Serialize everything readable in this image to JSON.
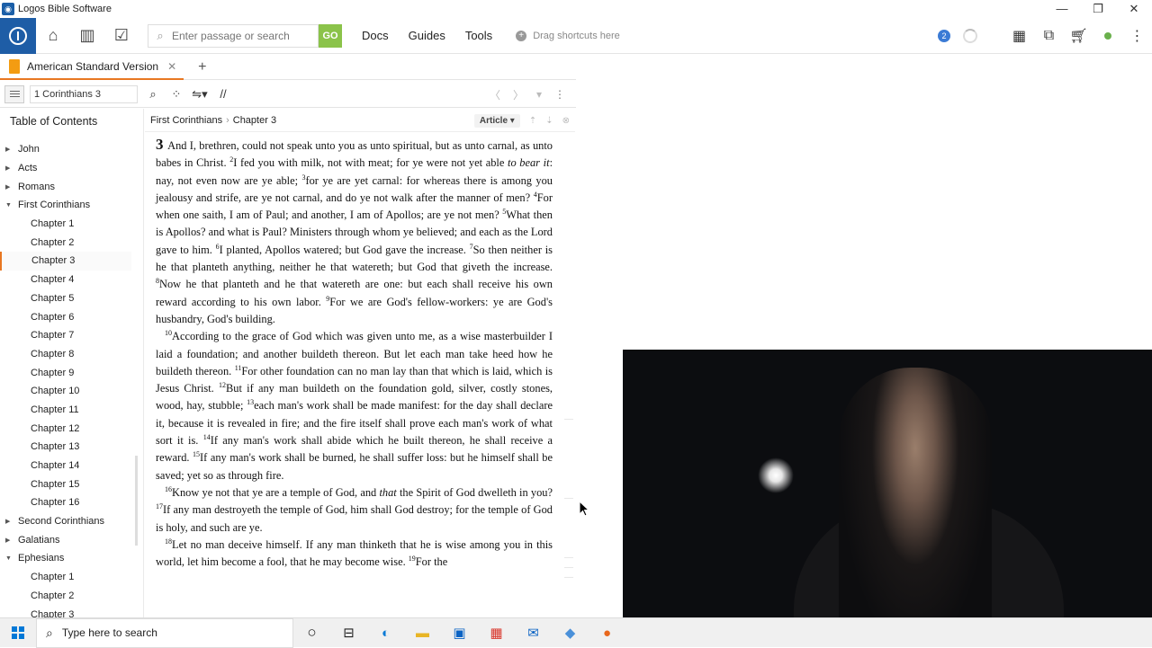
{
  "window": {
    "title": "Logos Bible Software",
    "minimize": "—",
    "restore": "❐",
    "close": "✕"
  },
  "toolbar": {
    "search_placeholder": "Enter passage or search",
    "go_label": "GO",
    "menu": [
      "Docs",
      "Guides",
      "Tools"
    ],
    "shortcuts_label": "Drag shortcuts here",
    "notification_count": "2"
  },
  "tab": {
    "label": "American Standard Version",
    "close": "✕",
    "add": "+"
  },
  "panel": {
    "reference": "1 Corinthians 3",
    "parallel_label": "//"
  },
  "toc": {
    "title": "Table of Contents",
    "items": [
      {
        "label": "John",
        "level": 0,
        "expanded": false
      },
      {
        "label": "Acts",
        "level": 0,
        "expanded": false
      },
      {
        "label": "Romans",
        "level": 0,
        "expanded": false
      },
      {
        "label": "First Corinthians",
        "level": 0,
        "expanded": true
      },
      {
        "label": "Chapter 1",
        "level": 1
      },
      {
        "label": "Chapter 2",
        "level": 1
      },
      {
        "label": "Chapter 3",
        "level": 1,
        "active": true
      },
      {
        "label": "Chapter 4",
        "level": 1
      },
      {
        "label": "Chapter 5",
        "level": 1
      },
      {
        "label": "Chapter 6",
        "level": 1
      },
      {
        "label": "Chapter 7",
        "level": 1
      },
      {
        "label": "Chapter 8",
        "level": 1
      },
      {
        "label": "Chapter 9",
        "level": 1
      },
      {
        "label": "Chapter 10",
        "level": 1
      },
      {
        "label": "Chapter 11",
        "level": 1
      },
      {
        "label": "Chapter 12",
        "level": 1
      },
      {
        "label": "Chapter 13",
        "level": 1
      },
      {
        "label": "Chapter 14",
        "level": 1
      },
      {
        "label": "Chapter 15",
        "level": 1
      },
      {
        "label": "Chapter 16",
        "level": 1
      },
      {
        "label": "Second Corinthians",
        "level": 0,
        "expanded": false
      },
      {
        "label": "Galatians",
        "level": 0,
        "expanded": false
      },
      {
        "label": "Ephesians",
        "level": 0,
        "expanded": true
      },
      {
        "label": "Chapter 1",
        "level": 1
      },
      {
        "label": "Chapter 2",
        "level": 1
      },
      {
        "label": "Chapter 3",
        "level": 1
      }
    ]
  },
  "content": {
    "breadcrumb": [
      "First Corinthians",
      "Chapter 3"
    ],
    "view_mode": "Article",
    "chapter_number": "3",
    "p1": {
      "v1": "And I, brethren, could not speak unto you as unto spiritual, but as unto carnal, as unto babes in Christ.",
      "v2n": "2",
      "v2": "I fed you with milk, not with meat; for ye were not yet able ",
      "v2i": "to bear it",
      "v2b": ": nay, not even now are ye able;",
      "v3n": "3",
      "v3": "for ye are yet carnal: for whereas there is among you jealousy and strife, are ye not carnal, and do ye not walk after the manner of men?",
      "v4n": "4",
      "v4": "For when one saith, I am of Paul; and another, I am of Apollos; are ye not men?",
      "v5n": "5",
      "v5": "What then is Apollos? and what is Paul? Ministers through whom ye believed; and each as the Lord gave to him.",
      "v6n": "6",
      "v6": "I planted, Apollos watered; but God gave the increase.",
      "v7n": "7",
      "v7": "So then neither is he that planteth anything, neither he that watereth; but God that giveth the increase.",
      "v8n": "8",
      "v8": "Now he that planteth and he that watereth are one: but each shall receive his own reward according to his own labor.",
      "v9n": "9",
      "v9": "For we are God's fellow-workers: ye are God's husbandry, God's building."
    },
    "p2": {
      "v10n": "10",
      "v10": "According to the grace of God which was given unto me, as a wise master­builder I laid a foundation; and another buildeth thereon. But let each man take heed how he buildeth thereon.",
      "v11n": "11",
      "v11": "For other foundation can no man lay than that which is laid, which is Jesus Christ.",
      "v12n": "12",
      "v12": "But if any man buildeth on the foundation gold, silver, costly stones, wood, hay, stubble;",
      "v13n": "13",
      "v13": "each man's work shall be made manifest: for the day shall declare it, because it is revealed in fire; and the fire itself shall prove each man's work of what sort it is.",
      "v14n": "14",
      "v14": "If any man's work shall abide which he built thereon, he shall receive a reward.",
      "v15n": "15",
      "v15": "If any man's work shall be burned, he shall suffer loss: but he himself shall be saved; yet so as through fire."
    },
    "p3": {
      "v16n": "16",
      "v16a": "Know ye not that ye are a temple of God, and ",
      "v16i": "that",
      "v16b": " the Spirit of God dwelleth in you?",
      "v17n": "17",
      "v17": "If any man destroyeth the temple of God, him shall God destroy; for the temple of God is holy, and such are ye."
    },
    "p4": {
      "v18n": "18",
      "v18": "Let no man deceive himself. If any man thinketh that he is wise among you in this world, let him become a fool, that he may become wise.",
      "v19n": "19",
      "v19": "For the"
    }
  },
  "taskbar": {
    "search_placeholder": "Type here to search"
  },
  "colors": {
    "accent": "#e87722",
    "logos_blue": "#1e5da6",
    "go_green": "#8bc34a"
  }
}
